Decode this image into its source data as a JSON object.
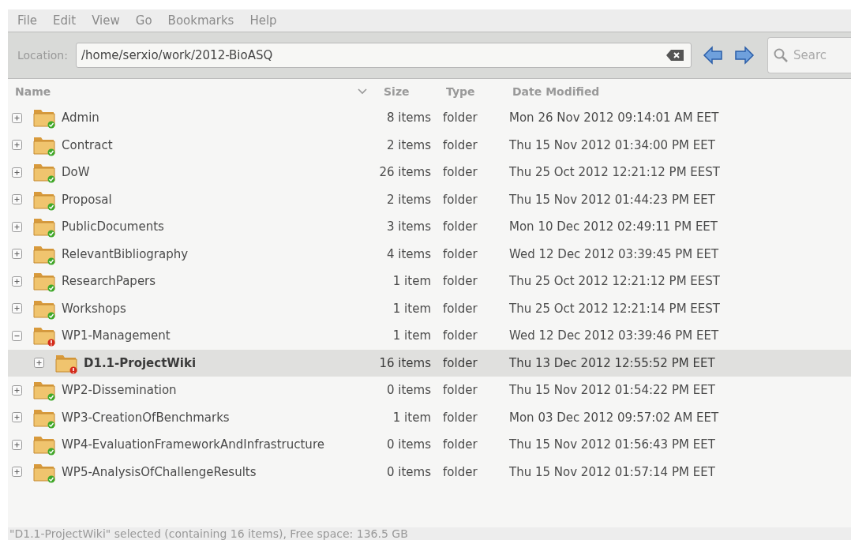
{
  "menu": [
    "File",
    "Edit",
    "View",
    "Go",
    "Bookmarks",
    "Help"
  ],
  "location": {
    "label": "Location:",
    "value": "/home/serxio/work/2012-BioASQ"
  },
  "search": {
    "placeholder": "Searc"
  },
  "columns": [
    {
      "label": "Name",
      "sorted": true
    },
    {
      "label": "Size",
      "sorted": false
    },
    {
      "label": "Type",
      "sorted": false
    },
    {
      "label": "Date Modified",
      "sorted": false
    }
  ],
  "rows": [
    {
      "name": "Admin",
      "size": "8 items",
      "type": "folder",
      "date": "Mon 26 Nov 2012 09:14:01 AM EET",
      "kind": "synced",
      "expanded": false,
      "selected": false
    },
    {
      "name": "Contract",
      "size": "2 items",
      "type": "folder",
      "date": "Thu 15 Nov 2012 01:34:00 PM EET",
      "kind": "synced",
      "expanded": false,
      "selected": false
    },
    {
      "name": "DoW",
      "size": "26 items",
      "type": "folder",
      "date": "Thu 25 Oct 2012 12:21:12 PM EEST",
      "kind": "synced",
      "expanded": false,
      "selected": false
    },
    {
      "name": "Proposal",
      "size": "2 items",
      "type": "folder",
      "date": "Thu 15 Nov 2012 01:44:23 PM EET",
      "kind": "synced",
      "expanded": false,
      "selected": false
    },
    {
      "name": "PublicDocuments",
      "size": "3 items",
      "type": "folder",
      "date": "Mon 10 Dec 2012 02:49:11 PM EET",
      "kind": "synced",
      "expanded": false,
      "selected": false
    },
    {
      "name": "RelevantBibliography",
      "size": "4 items",
      "type": "folder",
      "date": "Wed 12 Dec 2012 03:39:45 PM EET",
      "kind": "synced",
      "expanded": false,
      "selected": false
    },
    {
      "name": "ResearchPapers",
      "size": "1 item",
      "type": "folder",
      "date": "Thu 25 Oct 2012 12:21:12 PM EEST",
      "kind": "synced",
      "expanded": false,
      "selected": false
    },
    {
      "name": "Workshops",
      "size": "1 item",
      "type": "folder",
      "date": "Thu 25 Oct 2012 12:21:14 PM EEST",
      "kind": "synced",
      "expanded": false,
      "selected": false
    },
    {
      "name": "WP1-Management",
      "size": "1 item",
      "type": "folder",
      "date": "Wed 12 Dec 2012 03:39:46 PM EET",
      "kind": "error",
      "expanded": true,
      "selected": false,
      "children": [
        {
          "name": "D1.1-ProjectWiki",
          "size": "16 items",
          "type": "folder",
          "date": "Thu 13 Dec 2012 12:55:52 PM EET",
          "kind": "error",
          "expanded": false,
          "selected": true
        }
      ]
    },
    {
      "name": "WP2-Dissemination",
      "size": "0 items",
      "type": "folder",
      "date": "Thu 15 Nov 2012 01:54:22 PM EET",
      "kind": "synced",
      "expanded": false,
      "selected": false
    },
    {
      "name": "WP3-CreationOfBenchmarks",
      "size": "1 item",
      "type": "folder",
      "date": "Mon 03 Dec 2012 09:57:02 AM EET",
      "kind": "synced",
      "expanded": false,
      "selected": false
    },
    {
      "name": "WP4-EvaluationFrameworkAndInfrastructure",
      "size": "0 items",
      "type": "folder",
      "date": "Thu 15 Nov 2012 01:56:43 PM EET",
      "kind": "synced",
      "expanded": false,
      "selected": false
    },
    {
      "name": "WP5-AnalysisOfChallengeResults",
      "size": "0 items",
      "type": "folder",
      "date": "Thu 15 Nov 2012 01:57:14 PM EET",
      "kind": "synced",
      "expanded": false,
      "selected": false
    }
  ],
  "status_bar": "\"D1.1-ProjectWiki\" selected (containing 16 items), Free space: 136.5 GB"
}
